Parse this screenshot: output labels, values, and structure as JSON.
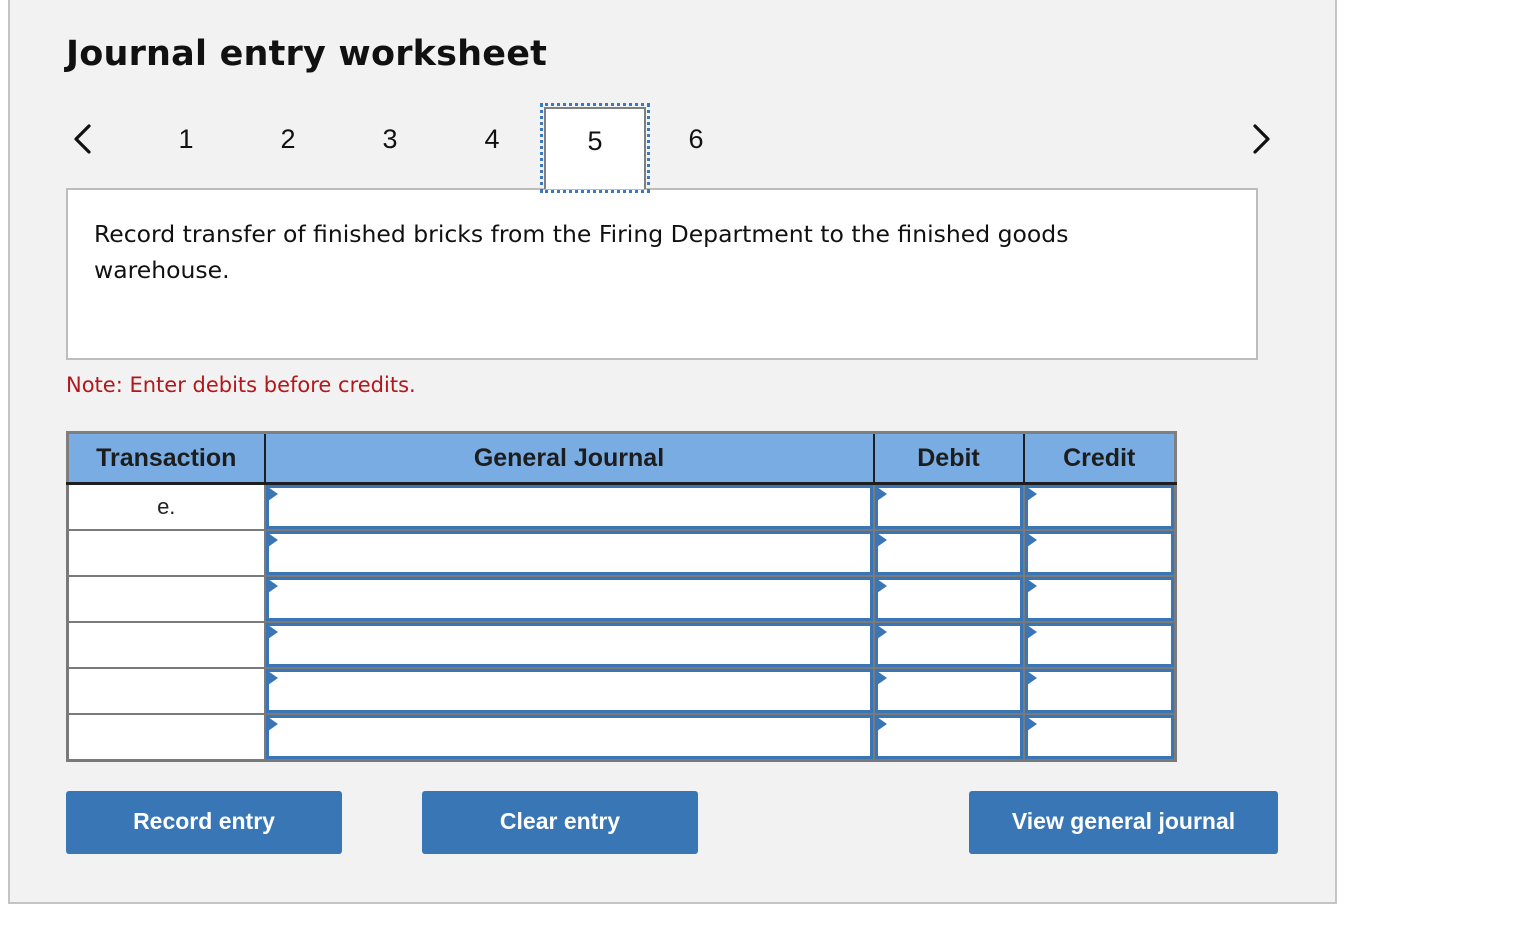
{
  "worksheet": {
    "title": "Journal entry worksheet",
    "prev_icon": "chevron-left-icon",
    "next_icon": "chevron-right-icon",
    "tabs": [
      {
        "label": "1",
        "active": false
      },
      {
        "label": "2",
        "active": false
      },
      {
        "label": "3",
        "active": false
      },
      {
        "label": "4",
        "active": false
      },
      {
        "label": "5",
        "active": true
      },
      {
        "label": "6",
        "active": false
      }
    ],
    "description": "Record transfer of finished bricks from the Firing Department to the finished goods warehouse.",
    "note": "Note: Enter debits before credits."
  },
  "journal_table": {
    "headers": [
      "Transaction",
      "General Journal",
      "Debit",
      "Credit"
    ],
    "rows": [
      {
        "transaction": "e.",
        "account": "",
        "debit": "",
        "credit": ""
      },
      {
        "transaction": "",
        "account": "",
        "debit": "",
        "credit": ""
      },
      {
        "transaction": "",
        "account": "",
        "debit": "",
        "credit": ""
      },
      {
        "transaction": "",
        "account": "",
        "debit": "",
        "credit": ""
      },
      {
        "transaction": "",
        "account": "",
        "debit": "",
        "credit": ""
      },
      {
        "transaction": "",
        "account": "",
        "debit": "",
        "credit": ""
      }
    ]
  },
  "buttons": {
    "record_entry": "Record entry",
    "clear_entry": "Clear entry",
    "view_general_journal": "View general journal"
  },
  "colors": {
    "header_bg": "#78ace2",
    "button_bg": "#3876b6",
    "input_border": "#3a75b5",
    "note_text": "#b3171c",
    "panel_bg": "#f2f2f2"
  }
}
